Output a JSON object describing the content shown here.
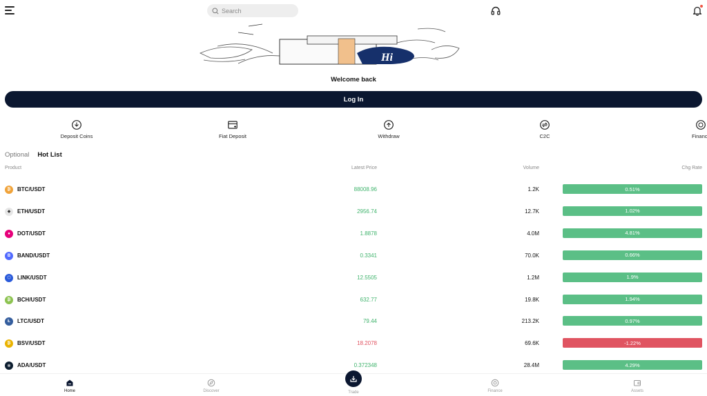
{
  "header": {
    "search_placeholder": "Search"
  },
  "welcome": {
    "title": "Welcome back",
    "login_label": "Log In",
    "banner_text": "Hi"
  },
  "quick_actions": [
    {
      "label": "Deposit Coins",
      "icon": "deposit-coins-icon"
    },
    {
      "label": "Fiat Deposit",
      "icon": "fiat-deposit-icon"
    },
    {
      "label": "Withdraw",
      "icon": "withdraw-icon"
    },
    {
      "label": "C2C",
      "icon": "c2c-icon"
    },
    {
      "label": "Financ",
      "icon": "finance-icon"
    }
  ],
  "tabs": [
    {
      "label": "Optional",
      "active": false
    },
    {
      "label": "Hot List",
      "active": true
    }
  ],
  "table": {
    "headers": {
      "product": "Product",
      "price": "Latest Price",
      "volume": "Volume",
      "change": "Chg Rate"
    },
    "rows": [
      {
        "pair": "BTC/USDT",
        "price": "88008.96",
        "volume": "1.2K",
        "change": "0.51%",
        "trend": "up",
        "color": "#f0a33a",
        "symbol": "₿"
      },
      {
        "pair": "ETH/USDT",
        "price": "2956.74",
        "volume": "12.7K",
        "change": "1.02%",
        "trend": "up",
        "color": "#e6e6e6",
        "symbol": "◆"
      },
      {
        "pair": "DOT/USDT",
        "price": "1.8878",
        "volume": "4.0M",
        "change": "4.81%",
        "trend": "up",
        "color": "#e6007a",
        "symbol": "●"
      },
      {
        "pair": "BAND/USDT",
        "price": "0.3341",
        "volume": "70.0K",
        "change": "0.66%",
        "trend": "up",
        "color": "#516aff",
        "symbol": "B"
      },
      {
        "pair": "LINK/USDT",
        "price": "12.5505",
        "volume": "1.2M",
        "change": "1.9%",
        "trend": "up",
        "color": "#2a5ada",
        "symbol": "⬡"
      },
      {
        "pair": "BCH/USDT",
        "price": "632.77",
        "volume": "19.8K",
        "change": "1.94%",
        "trend": "up",
        "color": "#8dc351",
        "symbol": "₿"
      },
      {
        "pair": "LTC/USDT",
        "price": "79.44",
        "volume": "213.2K",
        "change": "0.97%",
        "trend": "up",
        "color": "#345d9d",
        "symbol": "Ł"
      },
      {
        "pair": "BSV/USDT",
        "price": "18.2078",
        "volume": "69.6K",
        "change": "-1.22%",
        "trend": "down",
        "color": "#eab300",
        "symbol": "₿"
      },
      {
        "pair": "ADA/USDT",
        "price": "0.372348",
        "volume": "28.4M",
        "change": "4.29%",
        "trend": "up",
        "color": "#0d1e30",
        "symbol": "✻"
      }
    ]
  },
  "bottom_nav": [
    {
      "label": "Home",
      "active": true
    },
    {
      "label": "Discover",
      "active": false
    },
    {
      "label": "Trade",
      "active": false
    },
    {
      "label": "Finance",
      "active": false
    },
    {
      "label": "Assets",
      "active": false
    }
  ],
  "colors": {
    "primary": "#0b1730",
    "up": "#5bbf86",
    "down": "#e05461",
    "price_up": "#3fb36c"
  }
}
